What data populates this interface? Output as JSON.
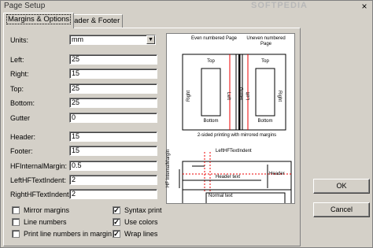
{
  "window": {
    "title": "Page Setup",
    "watermark": "SOFTPEDIA",
    "close_glyph": "×"
  },
  "tabs": [
    {
      "label": "Margins & Options"
    },
    {
      "label": "Header & Footer"
    }
  ],
  "form": {
    "units": {
      "label": "Units:",
      "value": "mm"
    },
    "left": {
      "label": "Left:",
      "value": "25"
    },
    "right": {
      "label": "Right:",
      "value": "15"
    },
    "top": {
      "label": "Top:",
      "value": "25"
    },
    "bottom": {
      "label": "Bottom:",
      "value": "25"
    },
    "gutter": {
      "label": "Gutter",
      "value": "0"
    },
    "header": {
      "label": "Header:",
      "value": "15"
    },
    "footer": {
      "label": "Footer:",
      "value": "15"
    },
    "hf_internal_margin": {
      "label": "HFInternalMargin:",
      "value": "0.5"
    },
    "left_hf_text_indent": {
      "label": "LeftHFTextIndent:",
      "value": "2"
    },
    "right_hf_text_indent": {
      "label": "RightHFTextIndent:",
      "value": "2"
    }
  },
  "checkboxes": [
    {
      "label": "Mirror margins",
      "checked": false
    },
    {
      "label": "Line numbers",
      "checked": false
    },
    {
      "label": "Print line numbers in margin",
      "checked": false
    },
    {
      "label": "Syntax print",
      "checked": true
    },
    {
      "label": "Use colors",
      "checked": true
    },
    {
      "label": "Wrap lines",
      "checked": true
    }
  ],
  "preview": {
    "even_page": "Even numbered Page",
    "uneven_page": "Uneven numbered Page",
    "top": "Top",
    "bottom": "Bottom",
    "right": "Right",
    "left": "Left",
    "gutter": "Gutter",
    "caption": "2-sided printing with mirrored margins",
    "left_hf_indent": "LeftHFTextIndent",
    "hf_internal_margin": "HF InternalMargin",
    "header": "Header",
    "header_text": "Header text",
    "normal_text": "Normal text"
  },
  "buttons": {
    "ok": "OK",
    "cancel": "Cancel"
  },
  "check_glyph": "✓"
}
